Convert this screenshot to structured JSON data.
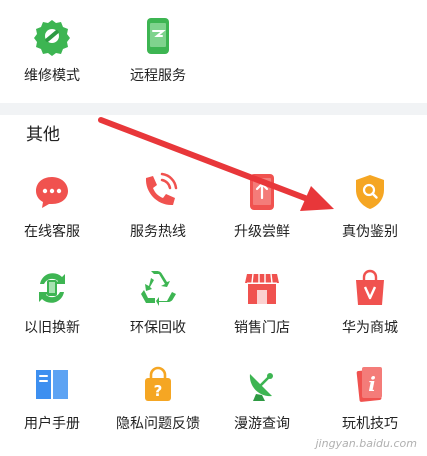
{
  "top_services": [
    {
      "label": "维修模式",
      "icon": "wrench-gear-icon"
    },
    {
      "label": "远程服务",
      "icon": "remote-phone-icon"
    }
  ],
  "other_section": {
    "title": "其他",
    "rows": [
      [
        {
          "label": "在线客服",
          "icon": "chat-bubble-icon"
        },
        {
          "label": "服务热线",
          "icon": "phone-call-icon"
        },
        {
          "label": "升级尝鲜",
          "icon": "upgrade-phone-icon"
        },
        {
          "label": "真伪鉴别",
          "icon": "shield-search-icon"
        }
      ],
      [
        {
          "label": "以旧换新",
          "icon": "trade-in-icon"
        },
        {
          "label": "环保回收",
          "icon": "recycle-icon"
        },
        {
          "label": "销售门店",
          "icon": "store-icon"
        },
        {
          "label": "华为商城",
          "icon": "shopping-bag-icon"
        }
      ],
      [
        {
          "label": "用户手册",
          "icon": "manual-book-icon"
        },
        {
          "label": "隐私问题反馈",
          "icon": "privacy-feedback-icon"
        },
        {
          "label": "漫游查询",
          "icon": "satellite-dish-icon"
        },
        {
          "label": "玩机技巧",
          "icon": "tips-icon"
        }
      ]
    ]
  },
  "watermark": "jingyan.baidu.com",
  "colors": {
    "green": "#3db552",
    "red": "#f0524f",
    "orange": "#f5a623",
    "blue": "#3d8ff0",
    "arrow": "#e8373a",
    "divider": "#f1f3f5"
  }
}
